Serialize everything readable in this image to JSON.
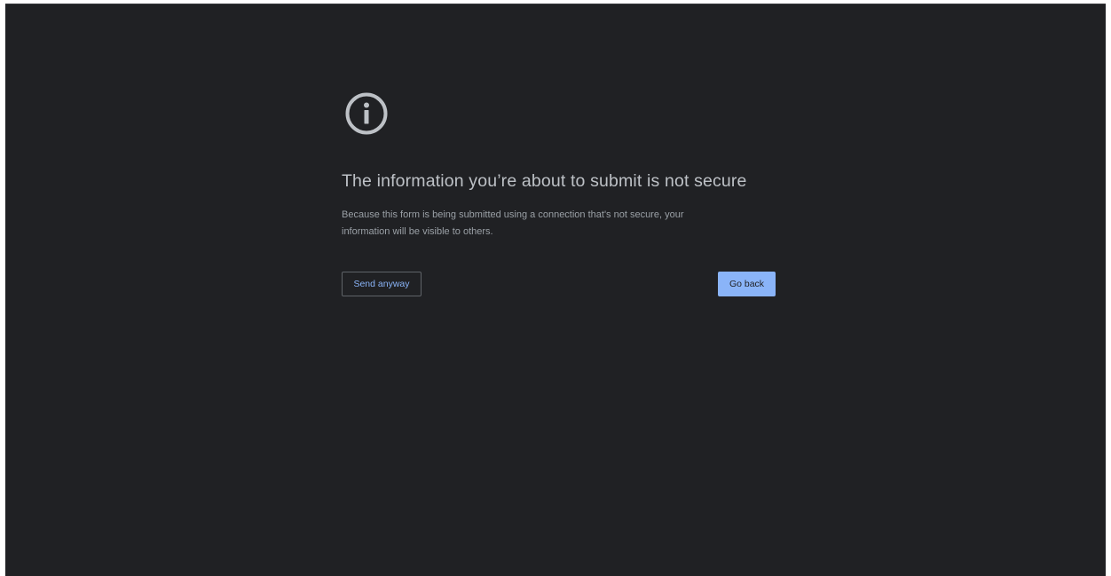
{
  "interstitial": {
    "icon": "info-icon",
    "heading": "The information you’re about to submit is not secure",
    "message_line_1": "Because this form is being submitted using a connection that's not secure, your",
    "message_line_2": "information will be visible to others.",
    "secondary_button_label": "Send anyway",
    "primary_button_label": "Go back"
  },
  "colors": {
    "background": "#202124",
    "heading": "#bdc1c6",
    "body_text": "#9aa0a6",
    "icon": "#bdc1c6",
    "accent": "#8ab4f8"
  }
}
